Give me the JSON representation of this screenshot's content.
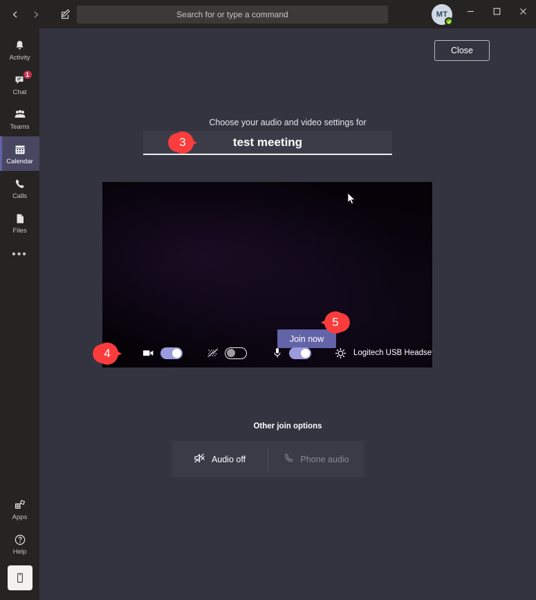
{
  "window": {
    "nav": {
      "back_icon": "chevron-left-icon",
      "forward_icon": "chevron-right-icon",
      "compose_icon": "compose-icon"
    },
    "search": {
      "placeholder": "Search for or type a command",
      "value": ""
    },
    "avatar": {
      "initials": "MT",
      "presence": "available"
    },
    "controls": {
      "minimize": "minimize-icon",
      "maximize": "maximize-icon",
      "close": "close-icon"
    }
  },
  "sidebar": {
    "items": [
      {
        "label": "Activity",
        "icon": "bell-icon",
        "selected": false,
        "badge": ""
      },
      {
        "label": "Chat",
        "icon": "chat-icon",
        "selected": false,
        "badge": "1"
      },
      {
        "label": "Teams",
        "icon": "teams-icon",
        "selected": false,
        "badge": ""
      },
      {
        "label": "Calendar",
        "icon": "calendar-icon",
        "selected": true,
        "badge": ""
      },
      {
        "label": "Calls",
        "icon": "phone-icon",
        "selected": false,
        "badge": ""
      },
      {
        "label": "Files",
        "icon": "files-icon",
        "selected": false,
        "badge": ""
      }
    ],
    "more_label": "•••",
    "bottom_items": [
      {
        "label": "Apps",
        "icon": "apps-icon"
      },
      {
        "label": "Help",
        "icon": "help-icon"
      }
    ],
    "mobile_icon": "mobile-phone-icon"
  },
  "main": {
    "close_label": "Close",
    "subtitle": "Choose your audio and video settings for",
    "meeting_title": "test meeting",
    "join_now_label": "Join now",
    "device_label": "Logitech USB Headset H...",
    "toggles": {
      "camera": {
        "icon": "camera-icon",
        "state": "on"
      },
      "background_blur": {
        "icon": "background-blur-icon",
        "state": "off"
      },
      "microphone": {
        "icon": "microphone-icon",
        "state": "on"
      }
    },
    "settings_icon": "gear-icon",
    "other_join": {
      "title": "Other join options",
      "options": [
        {
          "label": "Audio off",
          "icon": "speaker-muted-icon",
          "enabled": true
        },
        {
          "label": "Phone audio",
          "icon": "phone-handset-icon",
          "enabled": false
        }
      ]
    }
  },
  "annotations": [
    {
      "number": "3",
      "direction": "right"
    },
    {
      "number": "4",
      "direction": "right"
    },
    {
      "number": "5",
      "direction": "left"
    }
  ],
  "colors": {
    "accent": "#6264a7",
    "toggle_on": "#9a9bdc",
    "badge": "#c4314b",
    "annotation": "#fa3c3c",
    "rail_bg": "#252423",
    "main_bg": "#33343f",
    "presence_green": "#6bb700"
  }
}
